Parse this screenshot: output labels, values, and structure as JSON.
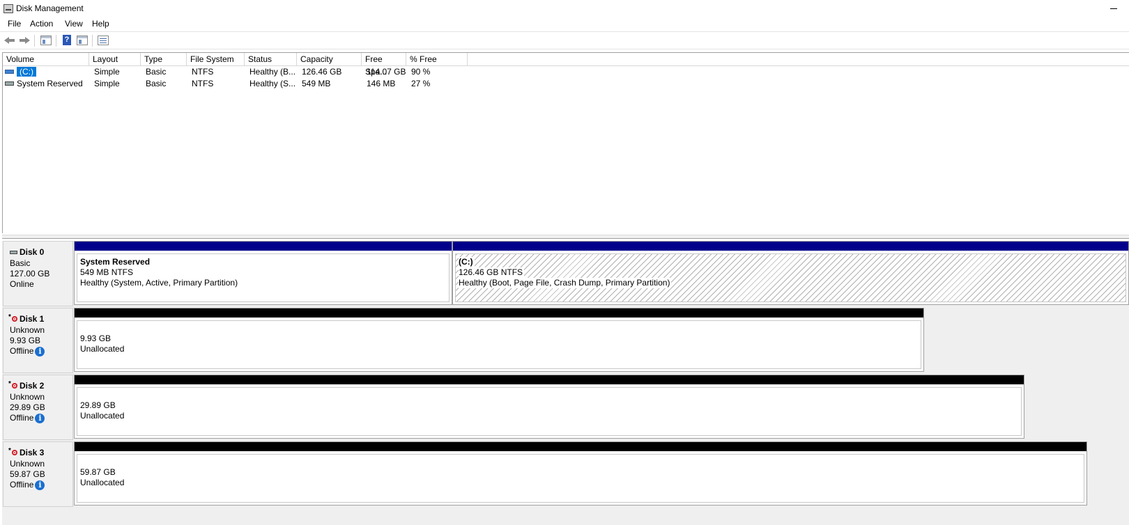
{
  "window": {
    "title": "Disk Management"
  },
  "menu": [
    "File",
    "Action",
    "View",
    "Help"
  ],
  "toolbar": {
    "help_glyph": "?"
  },
  "volume_table": {
    "columns": [
      "Volume",
      "Layout",
      "Type",
      "File System",
      "Status",
      "Capacity",
      "Free Spa...",
      "% Free"
    ],
    "rows": [
      {
        "volume": "(C:)",
        "layout": "Simple",
        "type": "Basic",
        "fs": "NTFS",
        "status": "Healthy (B...",
        "capacity": "126.46 GB",
        "free": "114.07 GB",
        "pct": "90 %",
        "selected": true
      },
      {
        "volume": "System Reserved",
        "layout": "Simple",
        "type": "Basic",
        "fs": "NTFS",
        "status": "Healthy (S...",
        "capacity": "549 MB",
        "free": "146 MB",
        "pct": "27 %",
        "selected": false
      }
    ]
  },
  "disks": [
    {
      "name": "Disk 0",
      "kind": "Basic",
      "size": "127.00 GB",
      "state": "Online",
      "partitions": [
        {
          "title": "System Reserved",
          "size_fs": "549 MB NTFS",
          "status": "Healthy (System, Active, Primary Partition)"
        },
        {
          "title": "(C:)",
          "size_fs": "126.46 GB NTFS",
          "status": "Healthy (Boot, Page File, Crash Dump, Primary Partition)"
        }
      ]
    },
    {
      "name": "Disk 1",
      "kind": "Unknown",
      "size": "9.93 GB",
      "state": "Offline",
      "unalloc_size": "9.93 GB",
      "unalloc_label": "Unallocated"
    },
    {
      "name": "Disk 2",
      "kind": "Unknown",
      "size": "29.89 GB",
      "state": "Offline",
      "unalloc_size": "29.89 GB",
      "unalloc_label": "Unallocated"
    },
    {
      "name": "Disk 3",
      "kind": "Unknown",
      "size": "59.87 GB",
      "state": "Offline",
      "unalloc_size": "59.87 GB",
      "unalloc_label": "Unallocated"
    }
  ],
  "colors": {
    "primary_partition": "#00008b",
    "unallocated": "#000000",
    "selection": "#0078d7",
    "info": "#1a6fd0",
    "offline": "#d0202a"
  }
}
